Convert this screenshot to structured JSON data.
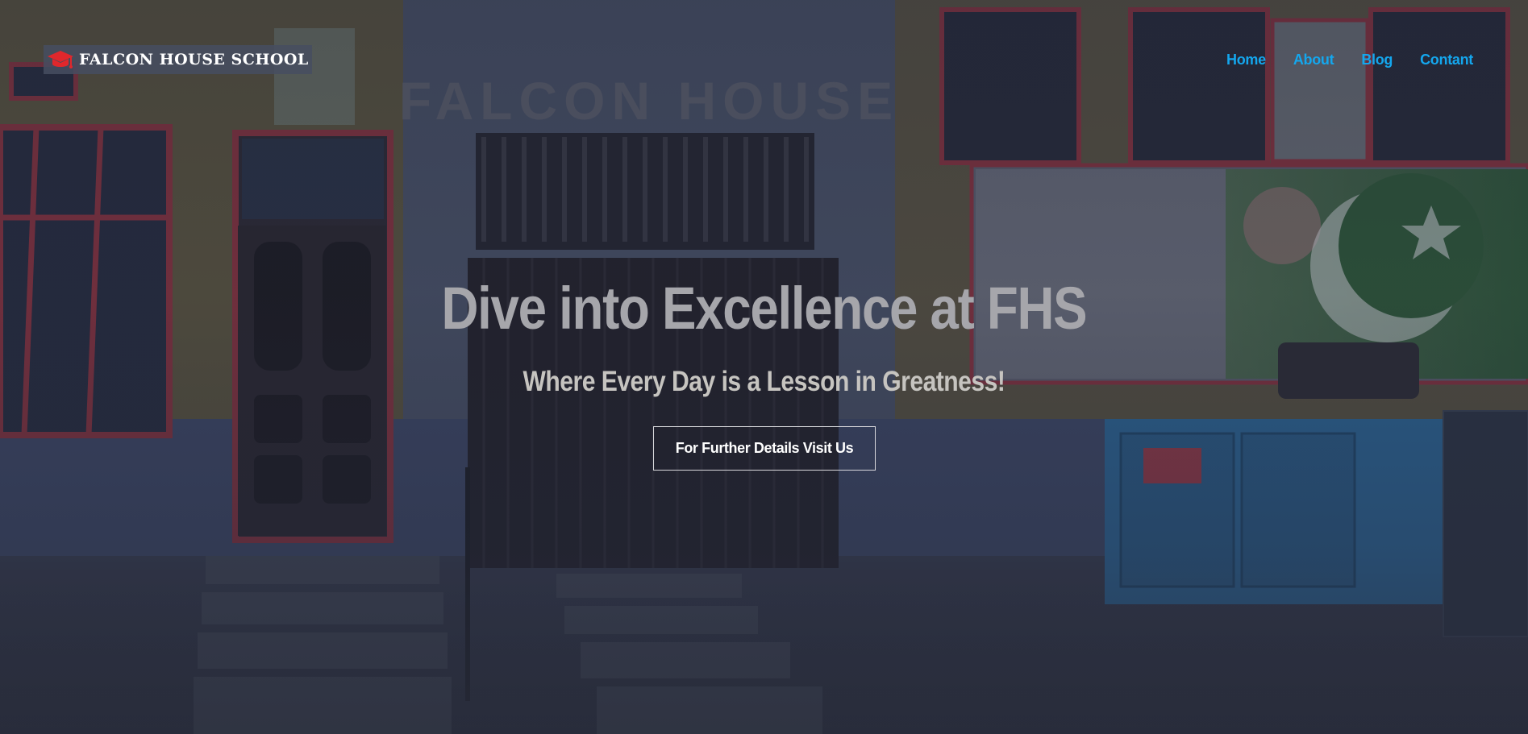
{
  "header": {
    "brand_name": "FALCON HOUSE SCHOOL",
    "brand_icon": "graduation-cap-icon",
    "nav": [
      {
        "label": "Home"
      },
      {
        "label": "About"
      },
      {
        "label": "Blog"
      },
      {
        "label": "Contant"
      }
    ]
  },
  "hero": {
    "headline": "Dive into Excellence at FHS",
    "subheadline": "Where Every Day is a Lesson in Greatness!",
    "cta_label": "For Further Details Visit Us",
    "background_image": "school-building-front-photo",
    "building_sign_text": "FALCON HOUSE"
  },
  "colors": {
    "nav_link": "#14a7ee",
    "brand_icon": "#e0272c",
    "headline": "#a6a6ab",
    "subheadline": "#c6c4c0",
    "cta_text": "#ffffff",
    "cta_border": "#d8d8dc"
  }
}
